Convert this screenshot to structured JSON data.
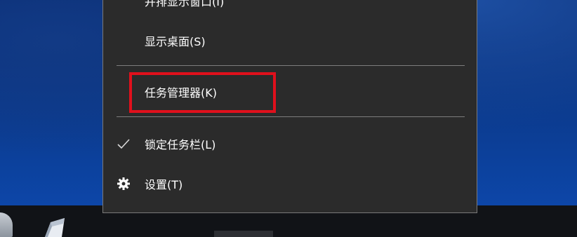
{
  "context_menu": {
    "items": [
      {
        "label": "并排显示窗口(I)"
      },
      {
        "label": "显示桌面(S)"
      },
      {
        "label": "任务管理器(K)"
      },
      {
        "label": "锁定任务栏(L)"
      },
      {
        "label": "设置(T)"
      }
    ]
  },
  "icons": {
    "checkmark": "checkmark-icon",
    "settings": "gear-icon"
  },
  "colors": {
    "menu_background": "#2b2b2b",
    "menu_text": "#ffffff",
    "highlight": "#e0101c",
    "taskbar": "#111317",
    "desktop": "#0b3b8f"
  }
}
